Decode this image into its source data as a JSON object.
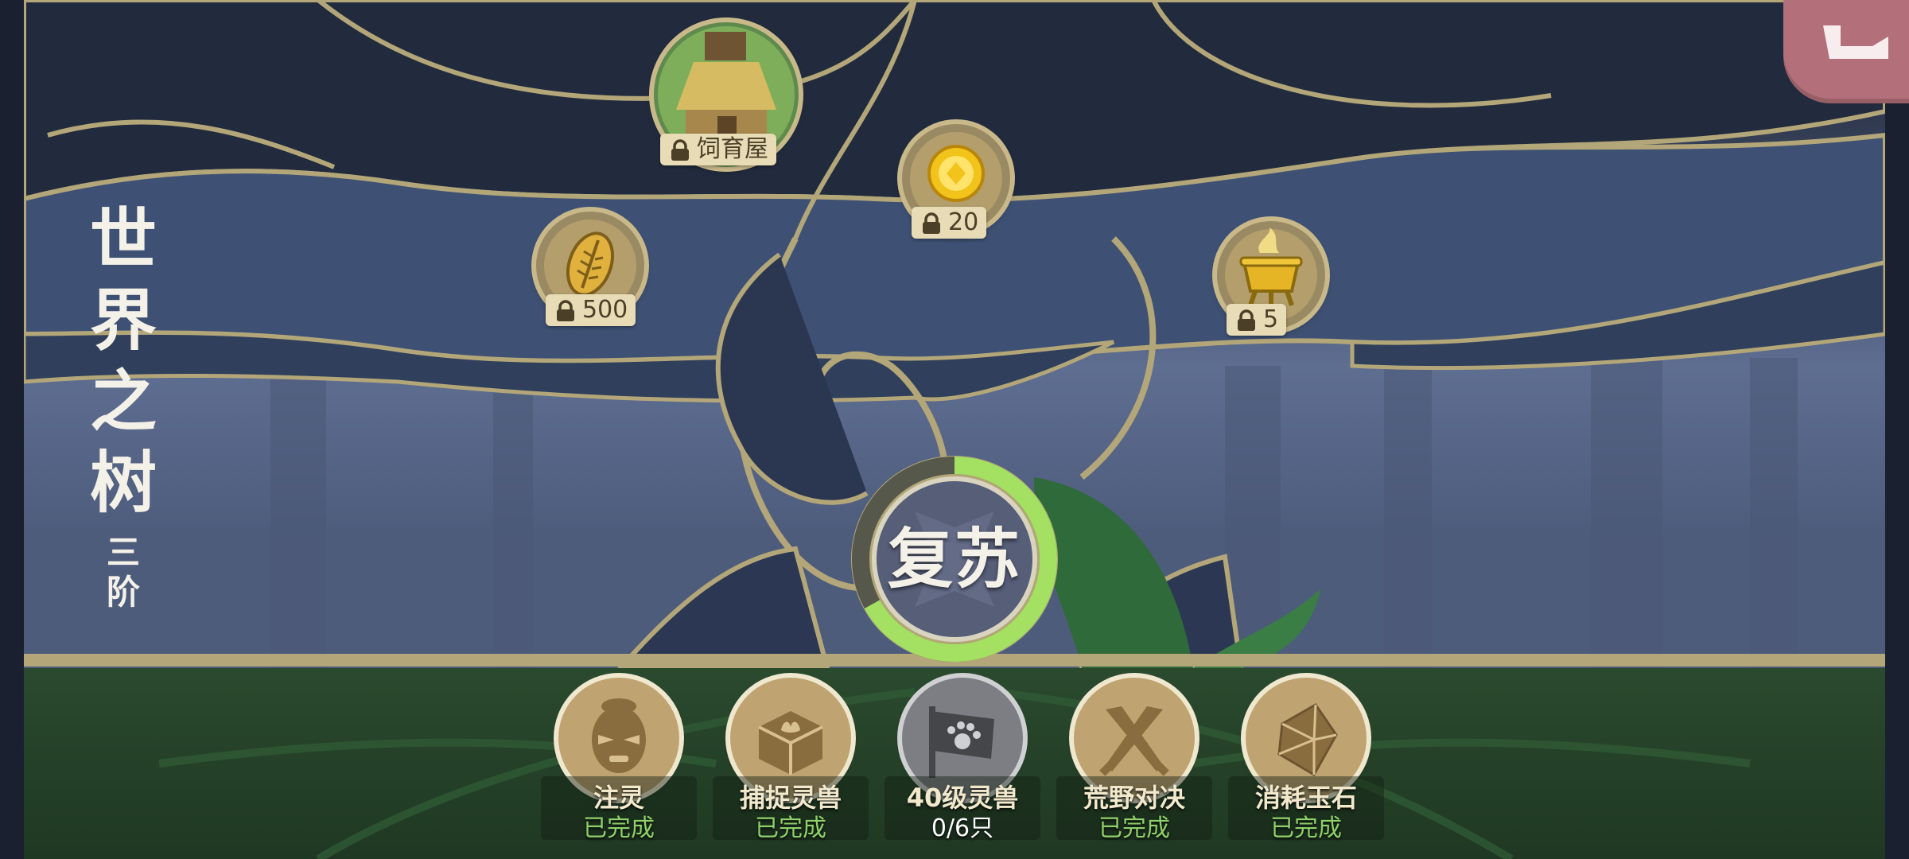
{
  "title": {
    "chars": [
      "世",
      "界",
      "之",
      "树"
    ],
    "tier": [
      "三",
      "阶"
    ]
  },
  "colors": {
    "accent_green": "#a4e061",
    "gold_line": "#b3a678",
    "task_done": "#8fd06a",
    "corner": "#b4707a"
  },
  "nodes": [
    {
      "id": "breeding-house",
      "icon": "hut-icon",
      "label": "饲育屋"
    },
    {
      "id": "gold-coin",
      "icon": "gold-coin-icon",
      "label": "20"
    },
    {
      "id": "seed",
      "icon": "seed-icon",
      "label": "500"
    },
    {
      "id": "golden-cauldron",
      "icon": "cauldron-icon",
      "label": "5"
    }
  ],
  "revive": {
    "label": "复苏",
    "progress": 0.67
  },
  "tasks": [
    {
      "name": "注灵",
      "state": "已完成",
      "icon": "mask-face-icon"
    },
    {
      "name": "捕捉灵兽",
      "state": "已完成",
      "icon": "leaf-box-icon"
    },
    {
      "name": "40级灵兽",
      "state": "0/6只",
      "icon": "paw-flag-icon"
    },
    {
      "name": "荒野对决",
      "state": "已完成",
      "icon": "crossed-swords-icon"
    },
    {
      "name": "消耗玉石",
      "state": "已完成",
      "icon": "crystal-icon"
    }
  ]
}
